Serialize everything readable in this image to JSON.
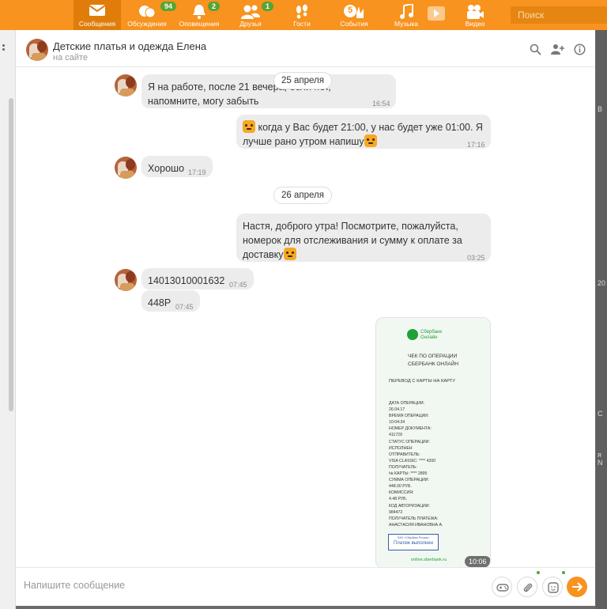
{
  "nav": {
    "items": [
      {
        "label": "Сообщения",
        "icon": "envelope-icon"
      },
      {
        "label": "Обсуждения",
        "icon": "discussions-icon",
        "badge": "94"
      },
      {
        "label": "Оповещения",
        "icon": "bell-icon",
        "badge": "2"
      },
      {
        "label": "Друзья",
        "icon": "friends-icon",
        "badge": "1"
      },
      {
        "label": "Гости",
        "icon": "footprints-icon"
      },
      {
        "label": "События",
        "icon": "events-icon",
        "badge": "5"
      },
      {
        "label": "Музыка",
        "icon": "music-note-icon"
      },
      {
        "label": "Видео",
        "icon": "video-camera-icon"
      }
    ],
    "search_placeholder": "Поиск"
  },
  "chat": {
    "title": "Детские платья и одежда Елена",
    "status": "на сайте",
    "dates": [
      "25 апреля",
      "26 апреля"
    ],
    "messages": [
      {
        "line1": "Я на работе, после 21 вечера, если нет,",
        "line2": "напомните, могу забыть",
        "time": "16:54"
      },
      {
        "line1": "когда у Вас будет 21:00, у нас будет уже 01:00. Я",
        "line2": "лучше рано утром напишу",
        "time": "17:16"
      },
      {
        "text": "Хорошо",
        "time": "17:19"
      },
      {
        "line1": "Настя, доброго утра! Посмотрите, пожалуйста,",
        "line2": "номерок для отслеживания и сумму к оплате за",
        "line3": "доставку",
        "time": "03:25"
      },
      {
        "text": "14013010001632",
        "time": "07:45"
      },
      {
        "text": "448Р",
        "time": "07:45"
      }
    ],
    "receipt": {
      "brand1": "Сбербанк",
      "brand2": "Онлайн",
      "heading1": "ЧЕК ПО ОПЕРАЦИИ",
      "heading2": "СБЕРБАНК ОНЛАЙН",
      "operation": "ПЕРЕВОД С КАРТЫ НА КАРТУ",
      "details": [
        "ДАТА ОПЕРАЦИИ:",
        "26.04.17",
        "ВРЕМЯ ОПЕРАЦИИ:",
        "10:04:34",
        "НОМЕР ДОКУМЕНТА:",
        "411729",
        "СТАТУС ОПЕРАЦИИ:",
        "ИСПОЛНЕН",
        "ОТПРАВИТЕЛЬ:",
        "VISA CLASSIC: **** 4200",
        "ПОЛУЧАТЕЛЬ:",
        "№ КАРТЫ: **** 2895",
        "СУММА ОПЕРАЦИИ:",
        "448.00 РУБ.",
        "КОМИССИЯ:",
        "4.48 РУБ.",
        "КОД АВТОРИЗАЦИИ:",
        "984472",
        "ПОЛУЧАТЕЛЬ ПЛАТЕЖА:",
        "АНАСТАСИЯ ИВАНОВНА А."
      ],
      "stamp_top": "ПАО «Сбербанк России»",
      "stamp_main": "Платеж выполнен",
      "site": "online.sberbank.ru",
      "time": "10:06"
    },
    "composer_placeholder": "Напишите сообщение"
  },
  "colors": {
    "brand": "#f7931e",
    "badge": "#58a433",
    "sber": "#21a038"
  }
}
